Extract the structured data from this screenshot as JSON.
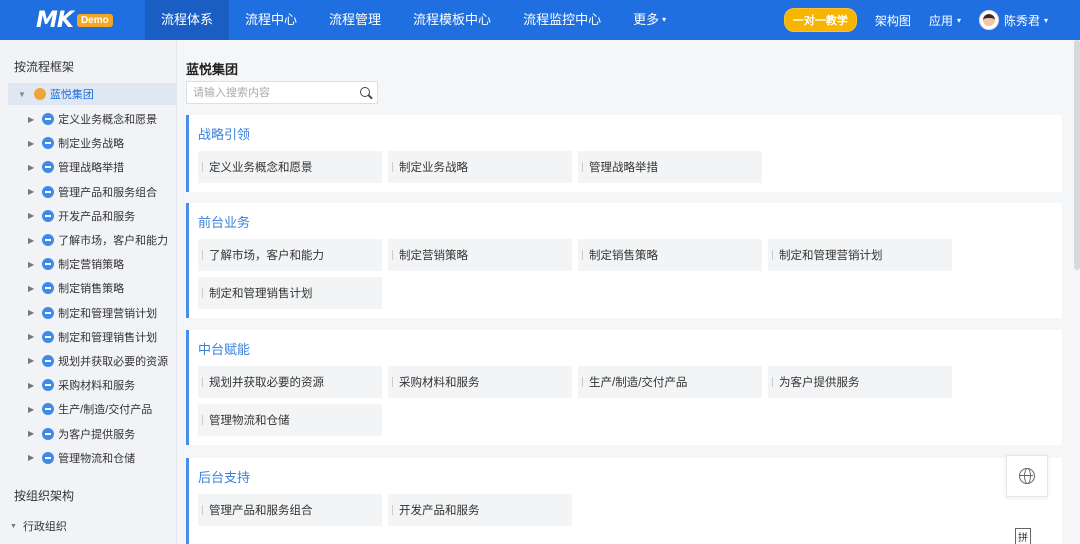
{
  "topbar": {
    "logo_mark": "MK",
    "logo_badge": "Demo",
    "nav": [
      {
        "label": "流程体系",
        "active": true
      },
      {
        "label": "流程中心"
      },
      {
        "label": "流程管理"
      },
      {
        "label": "流程模板中心"
      },
      {
        "label": "流程监控中心"
      },
      {
        "label": "更多"
      }
    ],
    "promo": "一对一教学",
    "architecture": "架构图",
    "apps": "应用",
    "user_name": "陈秀君"
  },
  "sidebar": {
    "heading_framework": "按流程框架",
    "root": "蓝悦集团",
    "items": [
      "定义业务概念和愿景",
      "制定业务战略",
      "管理战略举措",
      "管理产品和服务组合",
      "开发产品和服务",
      "了解市场，客户和能力",
      "制定营销策略",
      "制定销售策略",
      "制定和管理营销计划",
      "制定和管理销售计划",
      "规划并获取必要的资源",
      "采购材料和服务",
      "生产/制造/交付产品",
      "为客户提供服务",
      "管理物流和仓储"
    ],
    "heading_org": "按组织架构",
    "org_item": "行政组织"
  },
  "main": {
    "title": "蓝悦集团",
    "search_placeholder": "请输入搜索内容",
    "sections": [
      {
        "title": "战略引领",
        "items": [
          "定义业务概念和愿景",
          "制定业务战略",
          "管理战略举措"
        ]
      },
      {
        "title": "前台业务",
        "items": [
          "了解市场，客户和能力",
          "制定营销策略",
          "制定销售策略",
          "制定和管理营销计划",
          "制定和管理销售计划"
        ]
      },
      {
        "title": "中台赋能",
        "items": [
          "规划并获取必要的资源",
          "采购材料和服务",
          "生产/制造/交付产品",
          "为客户提供服务",
          "管理物流和仓储"
        ]
      },
      {
        "title": "后台支持",
        "items": [
          "管理产品和服务组合",
          "开发产品和服务"
        ]
      }
    ],
    "ime_label": "拼"
  },
  "colors": {
    "brand": "#1f6fe0",
    "accent": "#4a8fe7",
    "root_icon": "#f0a43c"
  }
}
